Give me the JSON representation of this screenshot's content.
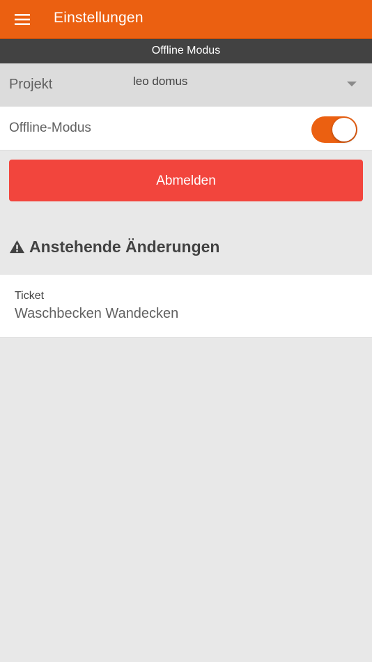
{
  "app_bar": {
    "title": "Einstellungen",
    "menu_icon": "hamburger-menu-icon",
    "color": "#eb6011"
  },
  "banner": {
    "text": "Offline Modus",
    "color": "#424242"
  },
  "project": {
    "label": "Projekt",
    "value": "leo domus",
    "dropdown_icon": "dropdown-arrow-icon"
  },
  "offline_mode": {
    "label": "Offline-Modus",
    "enabled": true,
    "toggle_color": "#eb6011"
  },
  "logout": {
    "label": "Abmelden",
    "color": "#f2453d"
  },
  "pending": {
    "icon": "warning-icon",
    "title": "Anstehende Änderungen",
    "items": [
      {
        "type": "Ticket",
        "title": "Waschbecken Wandecken"
      }
    ]
  }
}
